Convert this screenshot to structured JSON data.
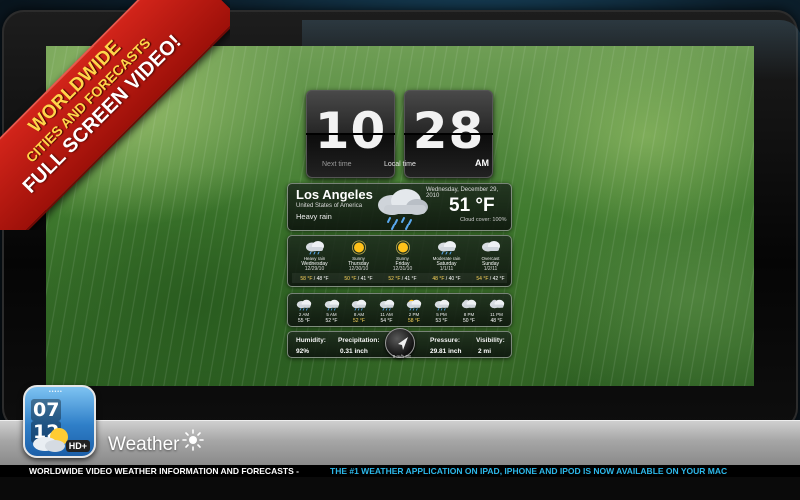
{
  "ribbon": {
    "line1": "WORLDWIDE",
    "line2": "CITIES AND FORECASTS",
    "line3": "FULL SCREEN VIDEO!"
  },
  "clock": {
    "hours": "10",
    "minutes": "28",
    "ampm": "AM",
    "next_label": "Next time",
    "local_label": "Local time"
  },
  "current": {
    "city": "Los Angeles",
    "country": "United States of America",
    "condition": "Heavy rain",
    "date": "Wednesday, December 29, 2010",
    "temp": "51 °F",
    "cloud_cover": "Cloud cover: 100%",
    "icon": "heavy-rain-cloud-icon"
  },
  "forecast": [
    {
      "desc": "Heavy rain",
      "day": "Wednesday",
      "date": "12/29/10",
      "hi": "58 °F",
      "lo": "48 °F",
      "icon": "rain-cloud-icon"
    },
    {
      "desc": "Sunny",
      "day": "Thursday",
      "date": "12/30/10",
      "hi": "50 °F",
      "lo": "41 °F",
      "icon": "sun-icon"
    },
    {
      "desc": "Sunny",
      "day": "Friday",
      "date": "12/31/10",
      "hi": "52 °F",
      "lo": "41 °F",
      "icon": "sun-icon"
    },
    {
      "desc": "Moderate rain",
      "day": "Saturday",
      "date": "1/1/11",
      "hi": "48 °F",
      "lo": "40 °F",
      "icon": "rain-cloud-icon"
    },
    {
      "desc": "Overcast",
      "day": "Sunday",
      "date": "1/2/11",
      "hi": "54 °F",
      "lo": "42 °F",
      "icon": "cloud-icon"
    }
  ],
  "hourly": [
    {
      "time": "2 AM",
      "temp": "55 °F",
      "highlight": false,
      "icon": "rain-cloud-icon"
    },
    {
      "time": "5 AM",
      "temp": "52 °F",
      "highlight": false,
      "icon": "rain-cloud-icon"
    },
    {
      "time": "8 AM",
      "temp": "52 °F",
      "highlight": true,
      "icon": "rain-cloud-icon"
    },
    {
      "time": "11 AM",
      "temp": "54 °F",
      "highlight": false,
      "icon": "rain-cloud-icon"
    },
    {
      "time": "2 PM",
      "temp": "58 °F",
      "highlight": true,
      "icon": "sun-cloud-icon"
    },
    {
      "time": "5 PM",
      "temp": "53 °F",
      "highlight": false,
      "icon": "rain-cloud-icon"
    },
    {
      "time": "8 PM",
      "temp": "50 °F",
      "highlight": false,
      "icon": "moon-cloud-icon"
    },
    {
      "time": "11 PM",
      "temp": "48 °F",
      "highlight": false,
      "icon": "moon-cloud-icon"
    }
  ],
  "stats": {
    "humidity_label": "Humidity:",
    "humidity": "92%",
    "precip_label": "Precipitation:",
    "precip": "0.31 inch",
    "wind": "0 m/h SE",
    "pressure_label": "Pressure:",
    "pressure": "29.81 inch",
    "visibility_label": "Visibility:",
    "visibility": "2 mi"
  },
  "app": {
    "title": "Weather",
    "icon_time_h": "07",
    "icon_time_m": "12",
    "icon_badge": "HD+"
  },
  "ticker": {
    "part1": "WORLDWIDE VIDEO WEATHER INFORMATION AND FORECASTS -",
    "part2": "THE #1 WEATHER APPLICATION ON IPAD, IPHONE AND IPOD IS NOW AVAILABLE ON YOUR MAC"
  },
  "colors": {
    "ribbon": "#c41a12",
    "ticker_accent": "#2db8ea",
    "highlight_temp": "#ffd85c"
  }
}
